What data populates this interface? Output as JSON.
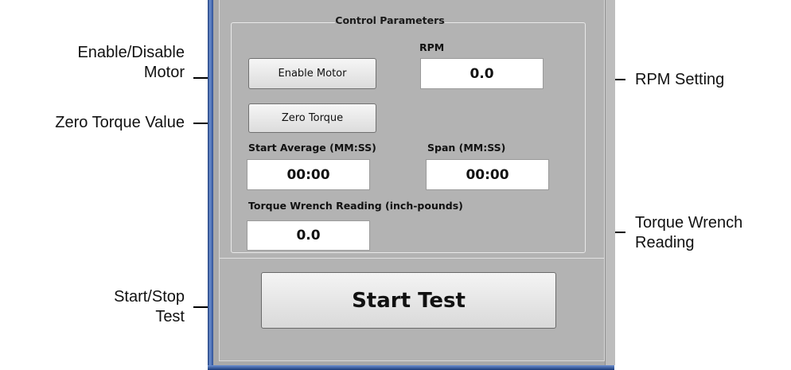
{
  "callouts": {
    "enable_disable_line1": "Enable/Disable",
    "enable_disable_line2": "Motor",
    "zero_torque": "Zero Torque Value",
    "rpm_setting": "RPM Setting",
    "torque_wrench_line1": "Torque Wrench",
    "torque_wrench_line2": "Reading",
    "start_stop_line1": "Start/Stop",
    "start_stop_line2": "Test"
  },
  "panel": {
    "group_title": "Control Parameters",
    "rpm_label": "RPM",
    "rpm_value": "0.0",
    "enable_motor_label": "Enable Motor",
    "zero_torque_label": "Zero Torque",
    "start_average_label": "Start Average (MM:SS)",
    "start_average_value": "00:00",
    "span_label": "Span (MM:SS)",
    "span_value": "00:00",
    "torque_reading_label": "Torque Wrench Reading (inch-pounds)",
    "torque_reading_value": "0.0",
    "start_test_label": "Start Test"
  }
}
